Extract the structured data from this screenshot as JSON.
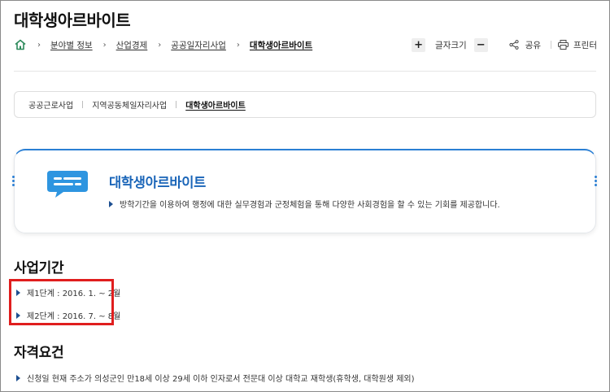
{
  "page": {
    "title": "대학생아르바이트"
  },
  "breadcrumb": {
    "home_icon": "home-icon",
    "items": [
      "분야별 정보",
      "산업경제",
      "공공일자리사업",
      "대학생아르바이트"
    ]
  },
  "tools": {
    "increase_label": "+",
    "font_size_label": "글자크기",
    "decrease_label": "−",
    "share_label": "공유",
    "share_icon": "share-icon",
    "print_label": "프린터",
    "print_icon": "printer-icon"
  },
  "subtabs": {
    "items": [
      "공공근로사업",
      "지역공동체일자리사업",
      "대학생아르바이트"
    ],
    "active_index": 2
  },
  "intro": {
    "icon": "chat-bubble-icon",
    "title": "대학생아르바이트",
    "description": "방학기간을 이용하여 행정에 대한 실무경험과 군정체험을 통해 다양한 사회경험을 할 수 있는 기회를 제공합니다."
  },
  "sections": {
    "period": {
      "title": "사업기간",
      "items": [
        "제1단계 : 2016. 1. ~ 2월",
        "제2단계 : 2016. 7. ~ 8월"
      ]
    },
    "requirements": {
      "title": "자격요건",
      "items": [
        "신청일 현재 주소가 의성군인 만18세 이상 29세 이하 인자로서 전문대 이상 대학교 재학생(휴학생, 대학원생 제외)"
      ]
    }
  },
  "colors": {
    "accent": "#2a7fd4",
    "title_blue": "#1a65b8",
    "bullet": "#1d4f91",
    "highlight": "#e01e1e"
  }
}
